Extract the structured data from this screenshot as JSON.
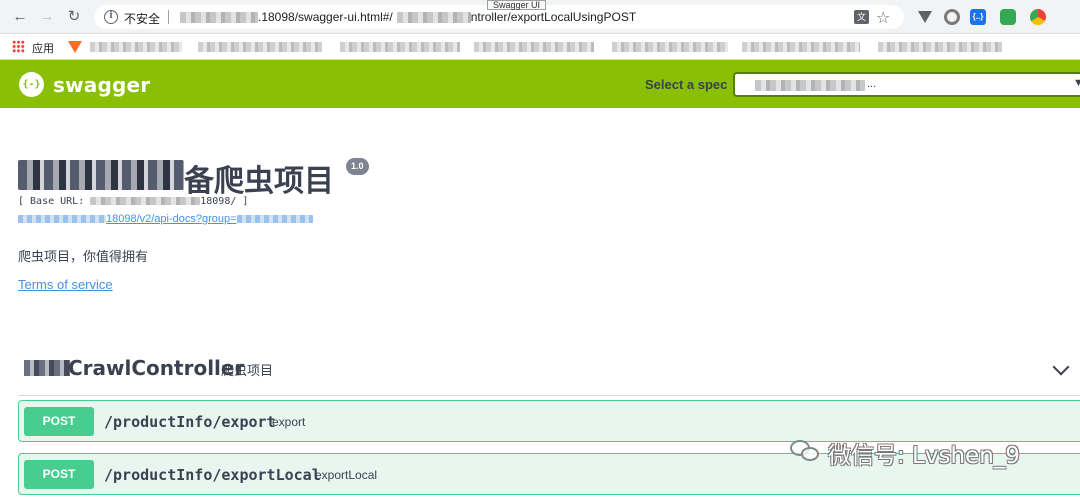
{
  "browser": {
    "tooltip": "Swagger UI",
    "security_label": "不安全",
    "url_visible_1": ".18098/swagger-ui.html#/",
    "url_visible_2": "ntroller/exportLocalUsingPOST",
    "bookmarks_apps_label": "应用"
  },
  "topbar": {
    "logo_icon_glyph": "{-}",
    "logo_text": "swagger",
    "spec_label": "Select a spec",
    "spec_value_suffix": "...",
    "brand_color": "#89bf04"
  },
  "info": {
    "title": "备爬虫项目",
    "version": "1.0",
    "base_url_prefix": "[ Base URL: ",
    "base_url_suffix": "18098/ ]",
    "api_docs_link": "18098/v2/api-docs?group=",
    "description": "爬虫项目，你值得拥有",
    "terms_of_service": "Terms of service"
  },
  "controller": {
    "name": "CrawlController",
    "description": "爬虫项目",
    "operations": [
      {
        "method": "POST",
        "path": "/productInfo/export",
        "summary": "export",
        "color": "#49cc90"
      },
      {
        "method": "POST",
        "path": "/productInfo/exportLocal",
        "summary": "exportLocal",
        "color": "#49cc90"
      }
    ]
  },
  "watermark": {
    "text": "微信号: Lvshen_9"
  }
}
